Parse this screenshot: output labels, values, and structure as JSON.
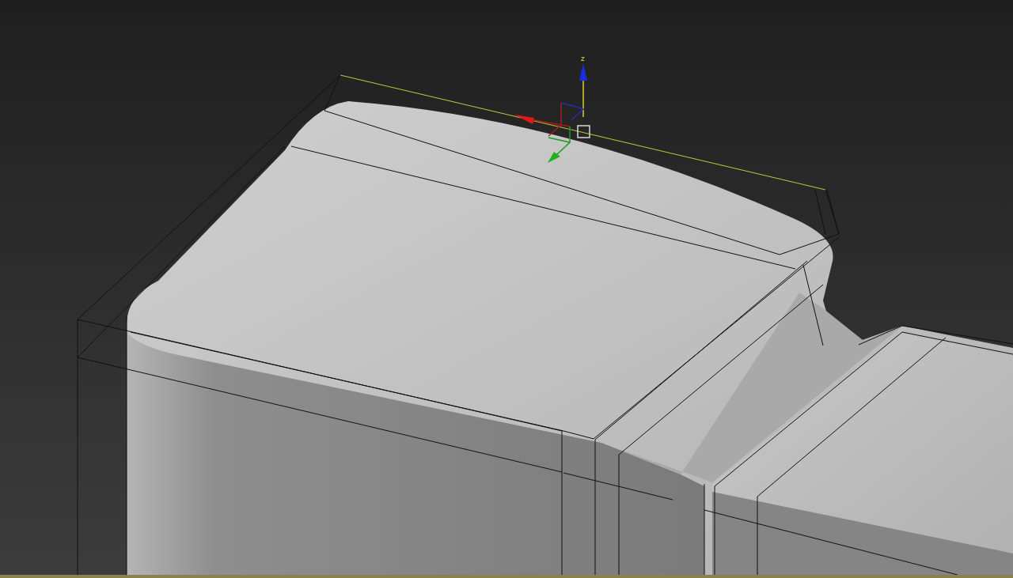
{
  "viewport": {
    "gizmo": {
      "z_label": "z"
    }
  }
}
